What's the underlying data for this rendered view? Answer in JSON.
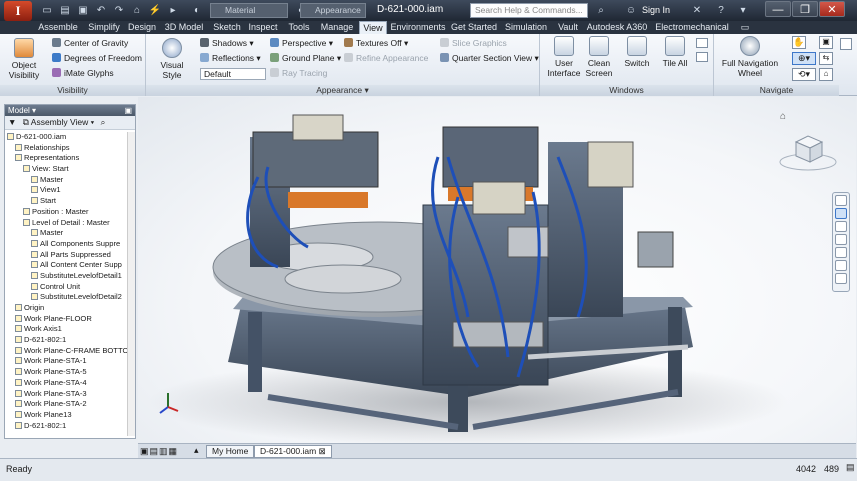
{
  "titlebar": {
    "app_logo": "I",
    "material": "Material",
    "appearance": "Appearance",
    "document": "D-621-000.iam",
    "search_placeholder": "Search Help & Commands...",
    "signin": "Sign In",
    "minimize": "—",
    "maximize": "❐",
    "close": "✕"
  },
  "tabs": [
    {
      "label": "Assemble"
    },
    {
      "label": "Simplify"
    },
    {
      "label": "Design"
    },
    {
      "label": "3D Model"
    },
    {
      "label": "Sketch"
    },
    {
      "label": "Inspect"
    },
    {
      "label": "Tools"
    },
    {
      "label": "Manage"
    },
    {
      "label": "View"
    },
    {
      "label": "Environments"
    },
    {
      "label": "Get Started"
    },
    {
      "label": "Simulation"
    },
    {
      "label": "Vault"
    },
    {
      "label": "Autodesk A360"
    },
    {
      "label": "Electromechanical"
    }
  ],
  "ribbon": {
    "visibility": {
      "title": "Visibility",
      "object_visibility": "Object\nVisibility",
      "center_of_gravity": "Center of Gravity",
      "degrees_of_freedom": "Degrees of Freedom",
      "imate_glyphs": "iMate Glyphs"
    },
    "appearance": {
      "title": "Appearance ▾",
      "visual_style": "Visual Style",
      "shadows": "Shadows ▾",
      "reflections": "Reflections ▾",
      "default": "Default",
      "perspective": "Perspective ▾",
      "ground_plane": "Ground Plane ▾",
      "ray_tracing": "Ray Tracing",
      "textures_off": "Textures Off ▾",
      "refine_appearance": "Refine Appearance",
      "slice_graphics": "Slice Graphics",
      "quarter_section_view": "Quarter Section View ▾"
    },
    "windows": {
      "title": "Windows",
      "user_interface": "User\nInterface",
      "clean_screen": "Clean\nScreen",
      "switch": "Switch",
      "tile_all": "Tile All"
    },
    "navigate": {
      "title": "Navigate",
      "full_navigation_wheel": "Full Navigation\nWheel"
    }
  },
  "browser": {
    "title": "Model ▾",
    "filter": "Assembly View ▾",
    "tree": [
      {
        "label": "D-621-000.iam",
        "level": 0
      },
      {
        "label": "Relationships",
        "level": 1
      },
      {
        "label": "Representations",
        "level": 1
      },
      {
        "label": "View: Start",
        "level": 2
      },
      {
        "label": "Master",
        "level": 3
      },
      {
        "label": "View1",
        "level": 3
      },
      {
        "label": "Start",
        "level": 3
      },
      {
        "label": "Position : Master",
        "level": 2
      },
      {
        "label": "Level of Detail : Master",
        "level": 2
      },
      {
        "label": "Master",
        "level": 3
      },
      {
        "label": "All Components Suppre",
        "level": 3
      },
      {
        "label": "All Parts Suppressed",
        "level": 3
      },
      {
        "label": "All Content Center Supp",
        "level": 3
      },
      {
        "label": "SubstituteLevelofDetail1",
        "level": 3
      },
      {
        "label": "Control Unit",
        "level": 3
      },
      {
        "label": "SubstituteLevelofDetail2",
        "level": 3
      },
      {
        "label": "Origin",
        "level": 1
      },
      {
        "label": "Work Plane-FLOOR",
        "level": 1
      },
      {
        "label": "Work Axis1",
        "level": 1
      },
      {
        "label": "D-621-802:1",
        "level": 1
      },
      {
        "label": "Work Plane-C-FRAME BOTTOM",
        "level": 1
      },
      {
        "label": "Work Plane-STA-1",
        "level": 1
      },
      {
        "label": "Work Plane-STA-5",
        "level": 1
      },
      {
        "label": "Work Plane-STA-4",
        "level": 1
      },
      {
        "label": "Work Plane-STA-3",
        "level": 1
      },
      {
        "label": "Work Plane-STA-2",
        "level": 1
      },
      {
        "label": "Work Plane13",
        "level": 1
      },
      {
        "label": "D-621-802:1",
        "level": 1
      }
    ]
  },
  "doc_tabs": {
    "home": "My Home",
    "doc": "D-621-000.iam"
  },
  "status": {
    "text": "Ready",
    "count1": "4042",
    "count2": "489"
  },
  "colors": {
    "frame": "#4e5e73",
    "blue_hose": "#1e4fb8",
    "orange": "#d9782a",
    "steel": "#9aa3ad"
  }
}
